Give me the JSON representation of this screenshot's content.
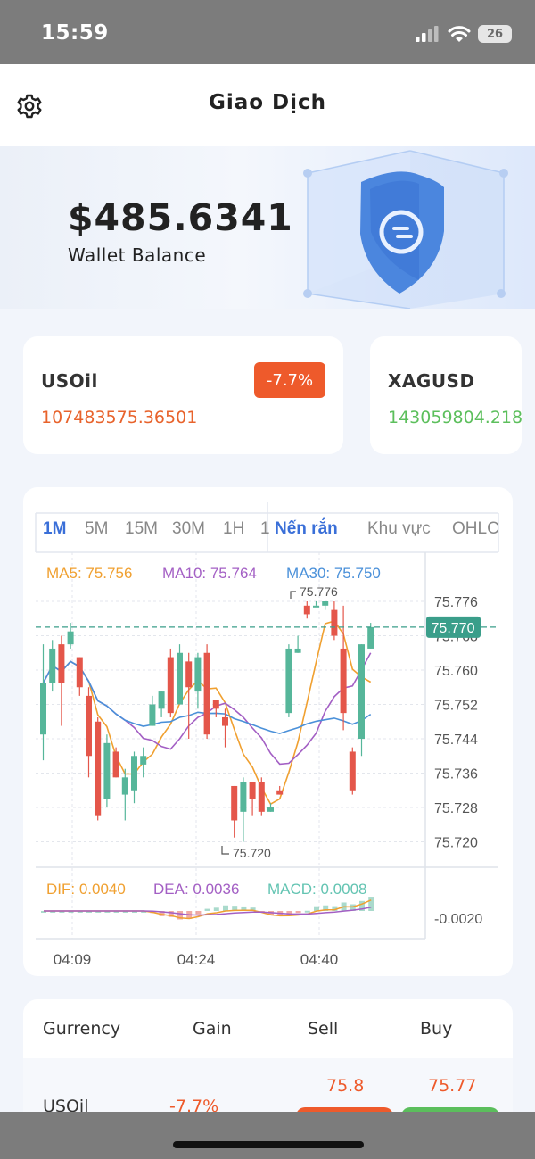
{
  "status_bar": {
    "time": "15:59",
    "battery": "26",
    "icons": [
      "signal-icon",
      "wifi-icon",
      "battery-icon"
    ]
  },
  "header": {
    "title": "Giao Dịch",
    "settings_icon": "gear-icon"
  },
  "wallet": {
    "balance": "$485.6341",
    "label": "Wallet Balance"
  },
  "tickers": [
    {
      "name": "USOil",
      "price": "107483575.36501",
      "change": "-7.7%",
      "price_color": "#e8632c"
    },
    {
      "name": "XAGUSD",
      "price": "143059804.218",
      "price_color": "#5cbf5c"
    }
  ],
  "chart": {
    "tabs": [
      "1M",
      "5M",
      "15M",
      "30M",
      "1H",
      "1"
    ],
    "active_tab": "1M",
    "modes": [
      "Nến rắn",
      "Khu vực",
      "OHLC"
    ],
    "active_mode": "Nến rắn",
    "legend": [
      {
        "label": "MA5: 75.756",
        "color": "#f0a030"
      },
      {
        "label": "MA10: 75.764",
        "color": "#a35fc4"
      },
      {
        "label": "MA30: 75.750",
        "color": "#4a90d9"
      }
    ],
    "current_price": "75.770",
    "high_label": "75.776",
    "low_label": "75.720",
    "macd_legend": [
      {
        "label": "DIF: 0.0040",
        "color": "#f0a030"
      },
      {
        "label": "DEA: 0.0036",
        "color": "#a35fc4"
      },
      {
        "label": "MACD: 0.0008",
        "color": "#63c4b2"
      }
    ],
    "macd_axis_label": "-0.0020",
    "x_labels": [
      "04:09",
      "04:24",
      "04:40"
    ],
    "colors": {
      "up": "#56b69a",
      "down": "#e4564a",
      "current": "#3a9e8a"
    }
  },
  "chart_data": {
    "type": "candlestick",
    "title": "",
    "y_ticks": [
      75.776,
      75.768,
      75.76,
      75.752,
      75.744,
      75.736,
      75.728,
      75.72
    ],
    "ylim": [
      75.716,
      75.782
    ],
    "x_tick_labels": [
      "04:09",
      "04:24",
      "04:40"
    ],
    "current_price": 75.77,
    "candles": [
      [
        75.745,
        75.757,
        75.739,
        75.766
      ],
      [
        75.757,
        75.765,
        75.755,
        75.767
      ],
      [
        75.766,
        75.757,
        75.747,
        75.768
      ],
      [
        75.766,
        75.769,
        75.765,
        75.771
      ],
      [
        75.763,
        75.756,
        75.754,
        75.763
      ],
      [
        75.754,
        75.74,
        75.735,
        75.756
      ],
      [
        75.748,
        75.726,
        75.725,
        75.749
      ],
      [
        75.73,
        75.743,
        75.728,
        75.745
      ],
      [
        75.741,
        75.735,
        75.735,
        75.742
      ],
      [
        75.731,
        75.735,
        75.725,
        75.737
      ],
      [
        75.732,
        75.74,
        75.729,
        75.741
      ],
      [
        75.738,
        75.74,
        75.735,
        75.742
      ],
      [
        75.747,
        75.752,
        75.747,
        75.754
      ],
      [
        75.751,
        75.755,
        75.749,
        75.755
      ],
      [
        75.763,
        75.75,
        75.749,
        75.765
      ],
      [
        75.752,
        75.764,
        75.752,
        75.766
      ],
      [
        75.762,
        75.756,
        75.744,
        75.764
      ],
      [
        75.755,
        75.763,
        75.751,
        75.764
      ],
      [
        75.764,
        75.745,
        75.744,
        75.766
      ],
      [
        75.753,
        75.751,
        75.749,
        75.753
      ],
      [
        75.749,
        75.747,
        75.742,
        75.751
      ],
      [
        75.733,
        75.725,
        75.721,
        75.733
      ],
      [
        75.727,
        75.734,
        75.72,
        75.735
      ],
      [
        75.734,
        75.73,
        75.726,
        75.734
      ],
      [
        75.734,
        75.727,
        75.726,
        75.735
      ],
      [
        75.727,
        75.728,
        75.727,
        75.729
      ],
      [
        75.732,
        75.731,
        75.731,
        75.733
      ],
      [
        75.75,
        75.765,
        75.749,
        75.766
      ],
      [
        75.764,
        75.765,
        75.764,
        75.768
      ],
      [
        75.775,
        75.773,
        75.772,
        75.776
      ],
      [
        75.775,
        75.775,
        75.775,
        75.776
      ],
      [
        75.775,
        75.776,
        75.774,
        75.776
      ],
      [
        75.774,
        75.768,
        75.767,
        75.776
      ],
      [
        75.765,
        75.75,
        75.746,
        75.775
      ],
      [
        75.741,
        75.732,
        75.731,
        75.742
      ],
      [
        75.744,
        75.766,
        75.74,
        75.766
      ],
      [
        75.765,
        75.77,
        75.765,
        75.771
      ]
    ]
  },
  "table": {
    "headers": [
      "Gurrency",
      "Gain",
      "Sell",
      "Buy"
    ],
    "rows": [
      {
        "currency": "USOil",
        "gain": "-7.7%",
        "sell": "75.8",
        "buy": "75.77"
      }
    ]
  }
}
